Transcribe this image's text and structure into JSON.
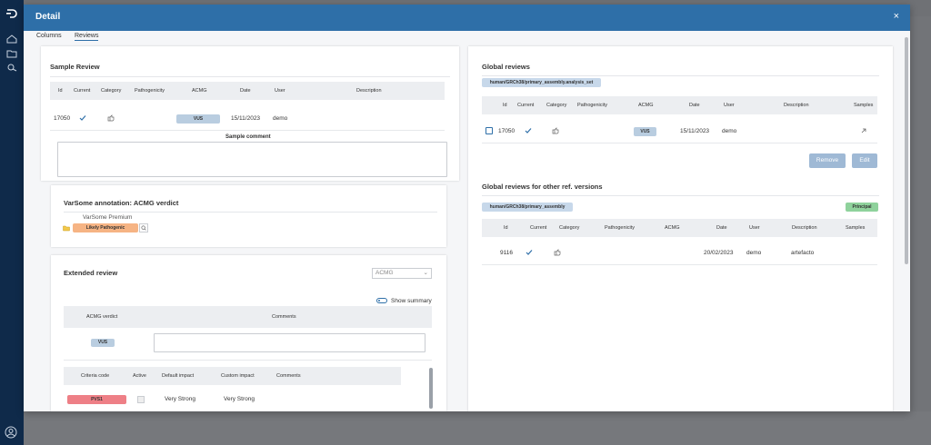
{
  "modal": {
    "title": "Detail",
    "close": "×"
  },
  "tabs": [
    "Columns",
    "Reviews"
  ],
  "sample_review": {
    "title": "Sample Review",
    "columns": [
      "Id",
      "Current",
      "Category",
      "Pathogenicity",
      "ACMG",
      "Date",
      "User",
      "Description"
    ],
    "row": {
      "id": "17050",
      "acmg": "VUS",
      "date": "15/11/2023",
      "user": "demo"
    },
    "comment_label": "Sample comment"
  },
  "varsome": {
    "title": "VarSome annotation: ACMG verdict",
    "source": "VarSome Premium",
    "verdict": "Likely Pathogenic"
  },
  "extended": {
    "title": "Extended review",
    "select_value": "ACMG",
    "show_summary": "Show summary",
    "verdict_header": "ACMG verdict",
    "comments_header": "Comments",
    "verdict": "VUS",
    "criteria_columns": [
      "Criteria code",
      "Active",
      "Default impact",
      "Custom impact",
      "Comments"
    ],
    "criteria_row": {
      "code": "PVS1",
      "default": "Very Strong",
      "custom": "Very Strong"
    }
  },
  "global": {
    "title": "Global reviews",
    "path_tag": "human/GRCh38/primary_assembly.analysis_set",
    "columns": [
      "Id",
      "Current",
      "Category",
      "Pathogenicity",
      "ACMG",
      "Date",
      "User",
      "Description",
      "Samples"
    ],
    "row": {
      "id": "17050",
      "acmg": "VUS",
      "date": "15/11/2023",
      "user": "demo"
    },
    "remove": "Remove",
    "edit": "Edit"
  },
  "global_other": {
    "title": "Global reviews for other ref. versions",
    "path_tag": "human/GRCh38/primary_assembly",
    "principal": "Principal",
    "columns": [
      "Id",
      "Current",
      "Category",
      "Pathogenicity",
      "ACMG",
      "Date",
      "User",
      "Description",
      "Samples"
    ],
    "row": {
      "id": "9116",
      "date": "20/02/2023",
      "user": "demo",
      "description": "artefacto"
    }
  },
  "colors": {
    "header": "#2e6fa8",
    "nav": "#0f2a4a",
    "vus": "#b9cde0",
    "likely_pathogenic": "#f6b484",
    "pvs1": "#ee7f86",
    "principal": "#8fd29c"
  }
}
